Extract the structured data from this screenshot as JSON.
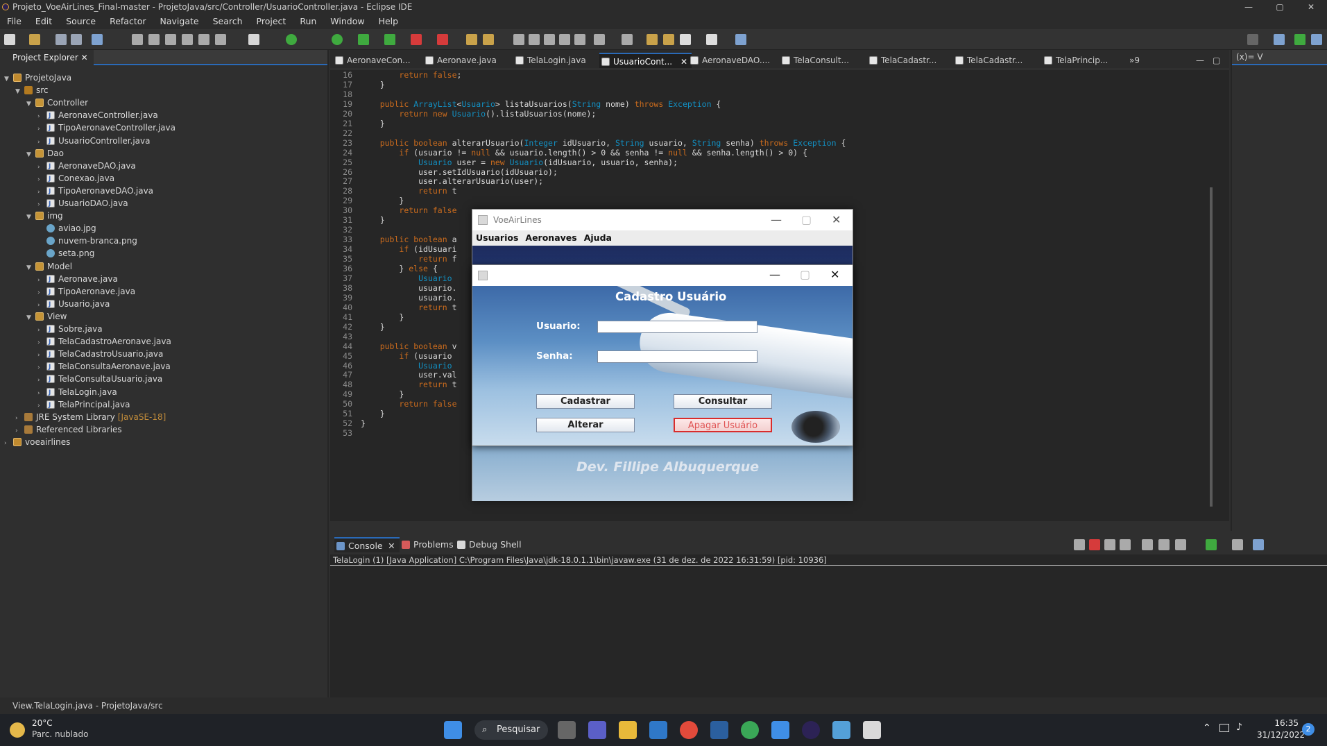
{
  "window": {
    "title": "Projeto_VoeAirLines_Final-master - ProjetoJava/src/Controller/UsuarioController.java - Eclipse IDE",
    "minimize": "—",
    "maximize": "▢",
    "close": "✕"
  },
  "menubar": [
    "File",
    "Edit",
    "Source",
    "Refactor",
    "Navigate",
    "Search",
    "Project",
    "Run",
    "Window",
    "Help"
  ],
  "explorer": {
    "tab_label": "Project Explorer",
    "tree": [
      {
        "label": "ProjetoJava",
        "icon": "project-icon"
      },
      {
        "label": "src",
        "icon": "folder-icon"
      },
      {
        "label": "Controller",
        "icon": "package-icon"
      },
      {
        "label": "AeronaveController.java",
        "icon": "java-file-icon"
      },
      {
        "label": "TipoAeronaveController.java",
        "icon": "java-file-icon"
      },
      {
        "label": "UsuarioController.java",
        "icon": "java-file-icon"
      },
      {
        "label": "Dao",
        "icon": "package-icon"
      },
      {
        "label": "AeronaveDAO.java",
        "icon": "java-file-icon"
      },
      {
        "label": "Conexao.java",
        "icon": "java-file-icon"
      },
      {
        "label": "TipoAeronaveDAO.java",
        "icon": "java-file-icon"
      },
      {
        "label": "UsuarioDAO.java",
        "icon": "java-file-icon"
      },
      {
        "label": "img",
        "icon": "package-icon"
      },
      {
        "label": "aviao.jpg",
        "icon": "image-file-icon"
      },
      {
        "label": "nuvem-branca.png",
        "icon": "image-file-icon"
      },
      {
        "label": "seta.png",
        "icon": "image-file-icon"
      },
      {
        "label": "Model",
        "icon": "package-icon"
      },
      {
        "label": "Aeronave.java",
        "icon": "java-file-icon"
      },
      {
        "label": "TipoAeronave.java",
        "icon": "java-file-icon"
      },
      {
        "label": "Usuario.java",
        "icon": "java-file-icon"
      },
      {
        "label": "View",
        "icon": "package-icon"
      },
      {
        "label": "Sobre.java",
        "icon": "java-file-icon"
      },
      {
        "label": "TelaCadastroAeronave.java",
        "icon": "java-file-icon"
      },
      {
        "label": "TelaCadastroUsuario.java",
        "icon": "java-file-icon"
      },
      {
        "label": "TelaConsultaAeronave.java",
        "icon": "java-file-icon"
      },
      {
        "label": "TelaConsultaUsuario.java",
        "icon": "java-file-icon"
      },
      {
        "label": "TelaLogin.java",
        "icon": "java-file-icon"
      },
      {
        "label": "TelaPrincipal.java",
        "icon": "java-file-icon"
      },
      {
        "label": "JRE System Library",
        "tag": "[JavaSE-18]",
        "icon": "library-icon"
      },
      {
        "label": "Referenced Libraries",
        "icon": "library-icon"
      },
      {
        "label": "voeairlines",
        "icon": "project-icon"
      }
    ]
  },
  "editor_tabs": [
    "AeronaveCon...",
    "Aeronave.java",
    "TelaLogin.java",
    "UsuarioCont...",
    "AeronaveDAO....",
    "TelaConsult...",
    "TelaCadastr...",
    "TelaCadastr...",
    "TelaPrincip...",
    "»9"
  ],
  "right_panel_tab": "(x)= V",
  "editor": {
    "line_numbers": [
      "16",
      "17",
      "18",
      "19",
      "20",
      "21",
      "22",
      "23",
      "24",
      "25",
      "26",
      "27",
      "28",
      "29",
      "30",
      "31",
      "32",
      "33",
      "34",
      "35",
      "36",
      "37",
      "38",
      "39",
      "40",
      "41",
      "42",
      "43",
      "44",
      "45",
      "46",
      "47",
      "48",
      "49",
      "50",
      "51",
      "52",
      "53"
    ],
    "lines": [
      "        return false;",
      "    }",
      "",
      "    public ArrayList<Usuario> listaUsuarios(String nome) throws Exception {",
      "        return new Usuario().listaUsuarios(nome);",
      "    }",
      "",
      "    public boolean alterarUsuario(Integer idUsuario, String usuario, String senha) throws Exception {",
      "        if (usuario != null && usuario.length() > 0 && senha != null && senha.length() > 0) {",
      "            Usuario user = new Usuario(idUsuario, usuario, senha);",
      "            user.setIdUsuario(idUsuario);",
      "            user.alterarUsuario(user);",
      "            return t",
      "        }",
      "        return false",
      "    }",
      "",
      "    public boolean a",
      "        if (idUsuari",
      "            return f",
      "        } else {",
      "            Usuario",
      "            usuario.",
      "            usuario.",
      "            return t",
      "        }",
      "    }",
      "",
      "    public boolean v",
      "        if (usuario                                                                         0) {",
      "            Usuario",
      "            user.val",
      "            return t",
      "        }",
      "        return false",
      "    }",
      "}",
      ""
    ]
  },
  "console": {
    "tabs": [
      "Console",
      "Problems",
      "Debug Shell"
    ],
    "path": "TelaLogin (1) [Java Application] C:\\Program Files\\Java\\jdk-18.0.1.1\\bin\\javaw.exe  (31 de dez. de 2022 16:31:59) [pid: 10936]"
  },
  "statusbar": {
    "text": "View.TelaLogin.java - ProjetoJava/src"
  },
  "app_main": {
    "title": "VoeAirLines",
    "menu": [
      "Usuarios",
      "Aeronaves",
      "Ajuda"
    ],
    "footer": "Dev. Fillipe Albuquerque"
  },
  "app_cadastro": {
    "title": "Cadastro Usuário",
    "usuario_label": "Usuario:",
    "senha_label": "Senha:",
    "usuario_value": "",
    "senha_value": "",
    "btn_cadastrar": "Cadastrar",
    "btn_consultar": "Consultar",
    "btn_alterar": "Alterar",
    "btn_apagar": "Apagar Usuário"
  },
  "taskbar": {
    "weather_temp": "20°C",
    "weather_desc": "Parc. nublado",
    "search_label": "Pesquisar",
    "time": "16:35",
    "date": "31/12/2022",
    "notifications": "2"
  },
  "colors": {
    "accent": "#2a6ab8",
    "danger": "#d92c2c"
  }
}
